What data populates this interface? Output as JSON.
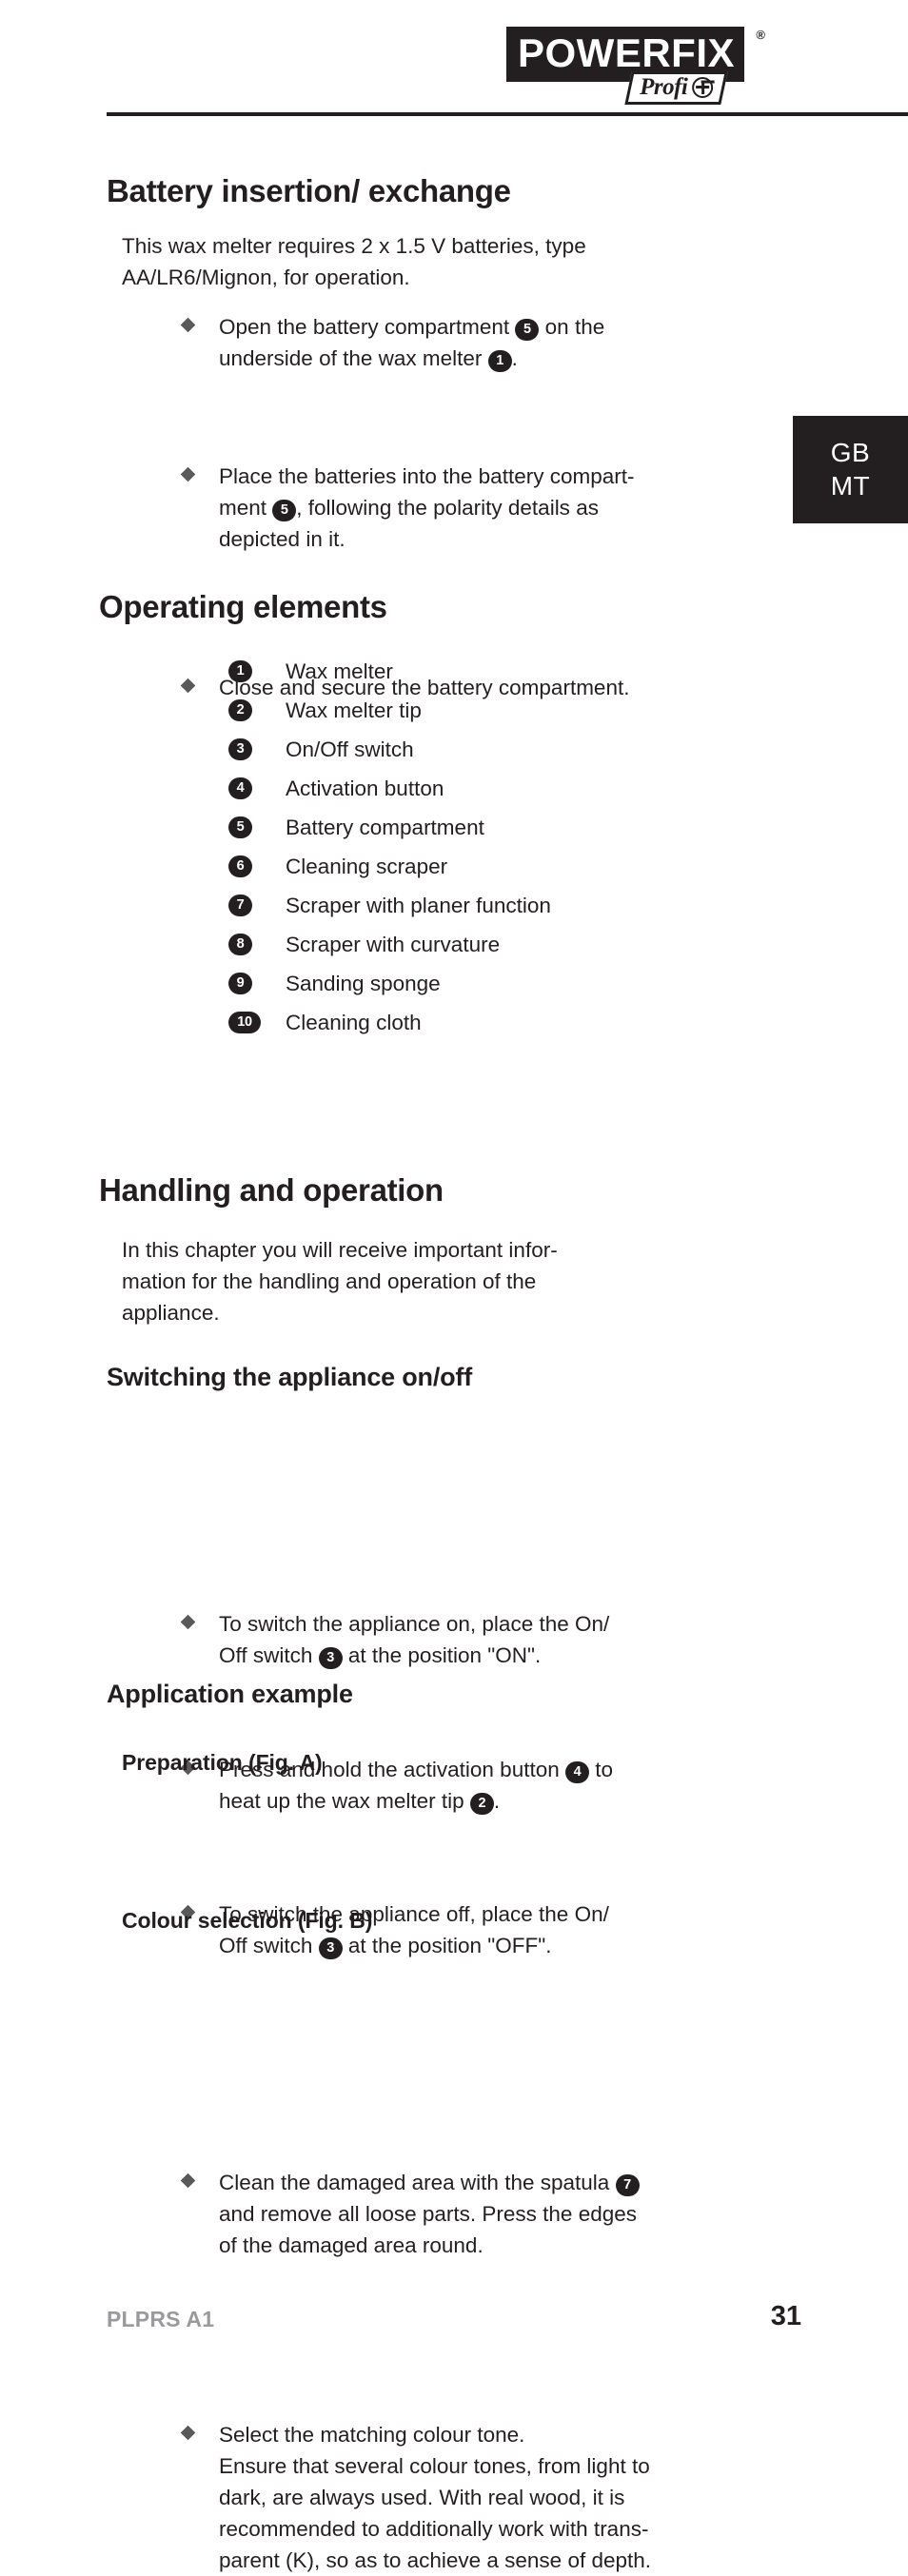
{
  "brand": {
    "logo_text": "POWERFIX",
    "registered_symbol": "®",
    "sub_badge_text": "Profi",
    "sub_badge_icon": "plus-circle-icon"
  },
  "language_tab": {
    "line1": "GB",
    "line2": "MT"
  },
  "sections": {
    "battery": {
      "heading": "Battery insertion/ exchange",
      "intro_line1": "This wax melter requires 2 x 1.5 V batteries, type",
      "intro_line2": "AA/LR6/Mignon, for operation.",
      "bullets": [
        {
          "line1_pre": "Open the battery compartment ",
          "badge1": "5",
          "line1_post": " on the",
          "line2_pre": "underside of the wax melter ",
          "badge2": "1",
          "line2_post": "."
        },
        {
          "line1": "Place the batteries into the battery compart-",
          "line2_pre": "ment ",
          "badge1": "5",
          "line2_post": ", following the polarity details as",
          "line3": "depicted in it."
        },
        {
          "line1": "Close and secure the battery compartment."
        }
      ]
    },
    "operating_elements": {
      "heading": "Operating elements",
      "items": [
        {
          "number": "1",
          "label": "Wax melter"
        },
        {
          "number": "2",
          "label": "Wax melter tip"
        },
        {
          "number": "3",
          "label": "On/Off switch"
        },
        {
          "number": "4",
          "label": "Activation button"
        },
        {
          "number": "5",
          "label": "Battery compartment"
        },
        {
          "number": "6",
          "label": "Cleaning scraper"
        },
        {
          "number": "7",
          "label": "Scraper with planer function"
        },
        {
          "number": "8",
          "label": "Scraper with curvature"
        },
        {
          "number": "9",
          "label": "Sanding sponge"
        },
        {
          "number": "10",
          "label": "Cleaning cloth"
        }
      ]
    },
    "handling": {
      "heading": "Handling and operation",
      "intro_line1": "In this chapter you will receive important infor-",
      "intro_line2": "mation for the handling and operation of the",
      "intro_line3": "appliance.",
      "switching": {
        "heading": "Switching the appliance on/off",
        "bullets": [
          {
            "line1": "To switch the appliance on, place the On/",
            "line2_pre": "Off switch ",
            "badge": "3",
            "line2_post": " at the position \"ON\"."
          },
          {
            "line1_pre": "Press and hold the activation button ",
            "badge1": "4",
            "line1_post": " to",
            "line2_pre": "heat up the wax melter tip ",
            "badge2": "2",
            "line2_post": "."
          },
          {
            "line1": "To switch the appliance off, place the On/",
            "line2_pre": "Off switch ",
            "badge": "3",
            "line2_post": " at the position \"OFF\"."
          }
        ]
      },
      "application": {
        "heading": "Application example",
        "preparation": {
          "heading": "Preparation (Fig. A)",
          "line1_pre": "Clean the damaged area with the spatula ",
          "badge": "7",
          "line2": "and remove all loose parts. Press the edges",
          "line3": "of the damaged area round."
        },
        "colour": {
          "heading": "Colour selection (Fig. B)",
          "line1": "Select the matching colour tone.",
          "line2": "Ensure that several colour tones, from light to",
          "line3": "dark, are always used. With real wood, it is",
          "line4": "recommended to additionally work with trans-",
          "line5": "parent (K), so as to achieve a sense of depth."
        }
      }
    }
  },
  "footer": {
    "product_code": "PLPRS A1",
    "page_number": "31"
  },
  "colors": {
    "ink": "#231f20",
    "bullet": "#595959",
    "footer_code": "#9a9a9c"
  }
}
